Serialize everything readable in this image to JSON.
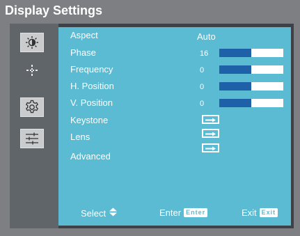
{
  "window": {
    "title": "Display Settings"
  },
  "sidebar": {
    "items": [
      {
        "icon": "brightness-icon",
        "selected": true
      },
      {
        "icon": "position-crosshair-icon",
        "selected": false
      },
      {
        "icon": "gear-icon",
        "selected": true
      },
      {
        "icon": "sliders-icon",
        "selected": true
      }
    ]
  },
  "menu": {
    "aspect": {
      "label": "Aspect",
      "value": "Auto"
    },
    "phase": {
      "label": "Phase",
      "value": "16",
      "level": 0.5
    },
    "frequency": {
      "label": "Frequency",
      "value": "0",
      "level": 0.5
    },
    "h_position": {
      "label": "H. Position",
      "value": "0",
      "level": 0.5
    },
    "v_position": {
      "label": "V. Position",
      "value": "0",
      "level": 0.5
    },
    "keystone": {
      "label": "Keystone",
      "icon": "enter-arrow-icon"
    },
    "lens": {
      "label": "Lens",
      "icon": "enter-arrow-icon"
    },
    "advanced": {
      "label": "Advanced"
    }
  },
  "footer": {
    "select": {
      "label": "Select",
      "icon": "up-down-triangle-icon"
    },
    "enter": {
      "label": "Enter",
      "key": "Enter"
    },
    "exit": {
      "label": "Exit",
      "key": "Exit"
    }
  },
  "colors": {
    "panel": "#5abbd2",
    "sidebar": "#5f6569",
    "frame": "#7d7f83",
    "bar_fill": "#1f61a9",
    "bar_track": "#ffffff"
  }
}
